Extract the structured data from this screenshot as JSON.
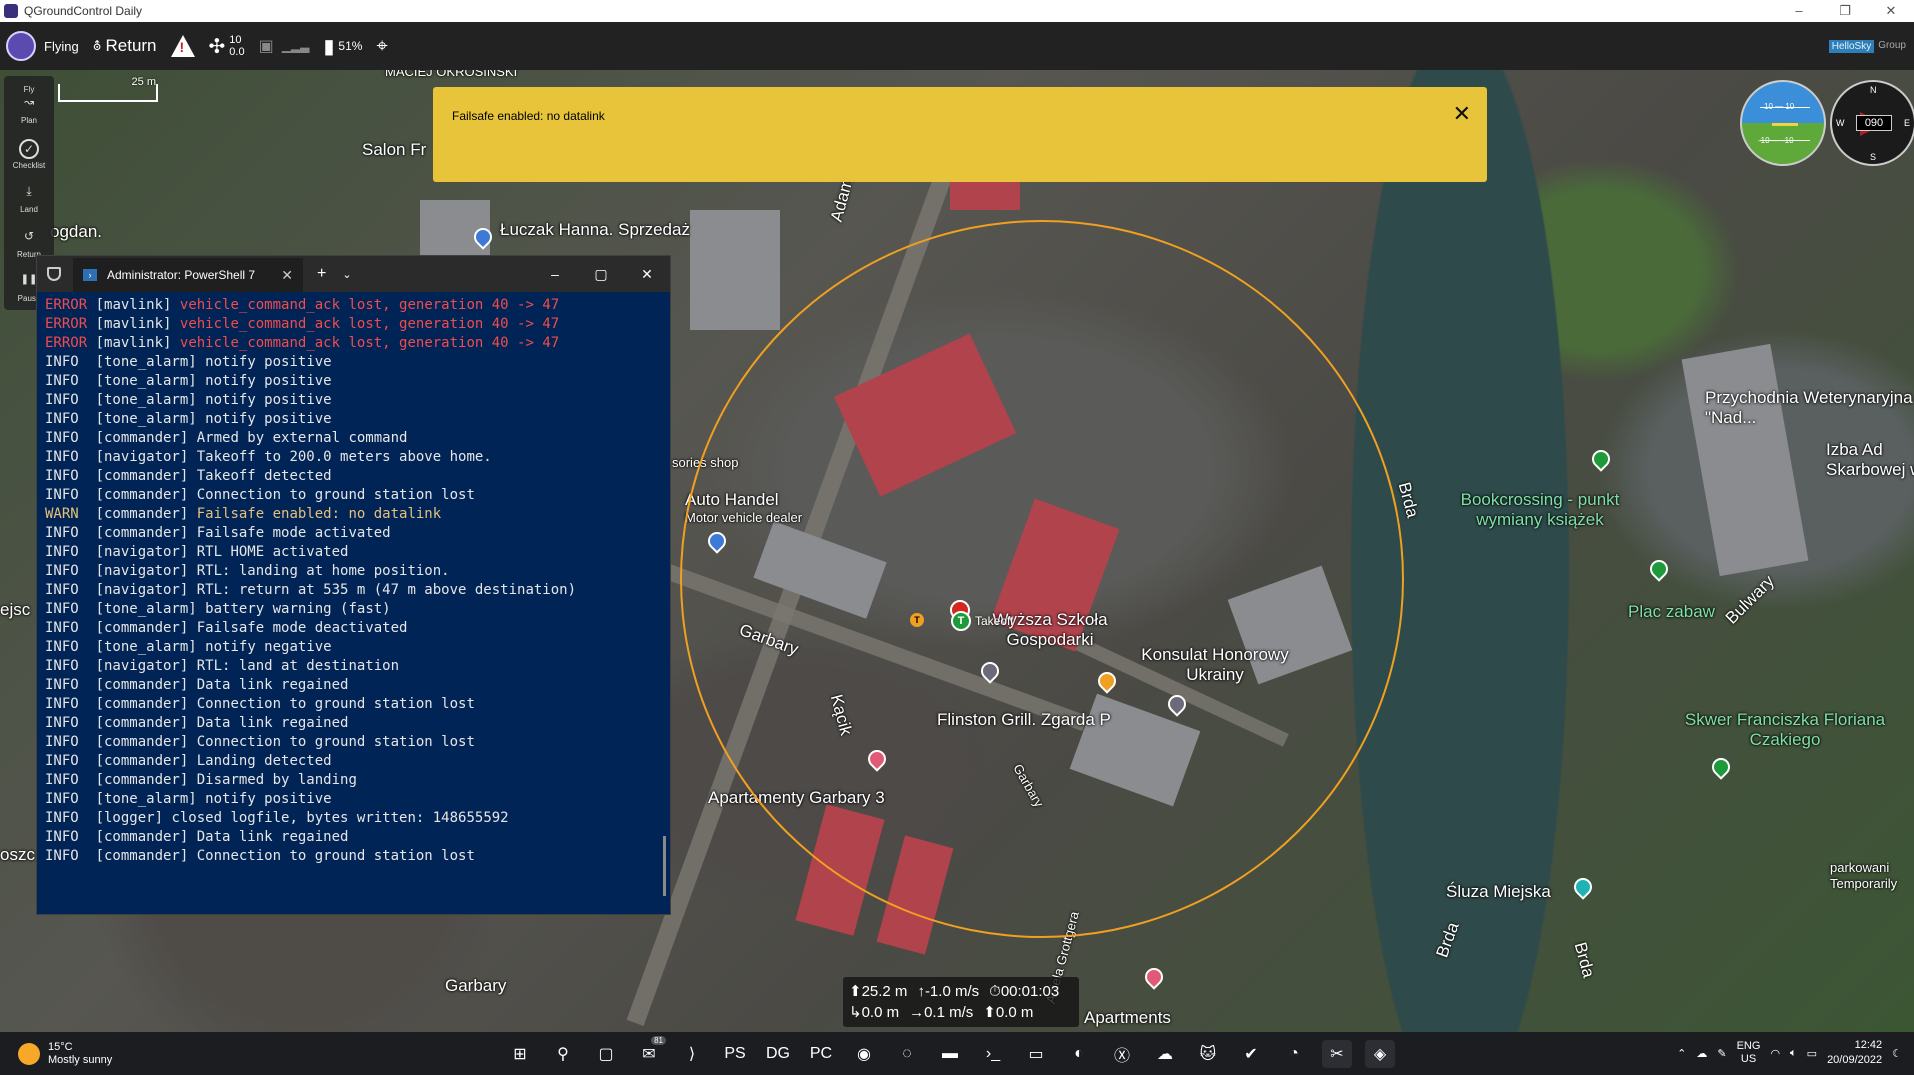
{
  "window": {
    "title": "QGroundControl Daily",
    "controls": [
      "–",
      "❐",
      "✕"
    ]
  },
  "toolbar": {
    "flight_status": "Flying",
    "flight_mode": "Return",
    "gps_count": "10",
    "gps_hdop": "0.0",
    "battery": "51%",
    "brand_left": "HelloSky",
    "brand_right": "Group"
  },
  "tools": [
    {
      "label": "Fly",
      "icon": "✈"
    },
    {
      "label": "Plan",
      "icon": "↝"
    },
    {
      "label": "Checklist",
      "icon": "✓"
    },
    {
      "label": "Land",
      "icon": "⤓"
    },
    {
      "label": "Return",
      "icon": "↺"
    },
    {
      "label": "Pause",
      "icon": "❚❚"
    }
  ],
  "map": {
    "scale": "25 m",
    "labels": [
      "MACIEJ OKROSINSKI",
      "Salon Fr",
      "ogdan.",
      "Łuczak Hanna. Sprzedaż",
      "Auto Handel",
      "Motor vehicle dealer",
      "sories shop",
      "Garbary",
      "Wyższa Szkoła Gospodarki",
      "Konsulat Honorowy Ukrainy",
      "Flinston Grill. Zgarda P",
      "Kącik",
      "Apartamenty Garbary 3",
      "Garbary",
      "Brda",
      "Bookcrossing - punkt wymiany książek",
      "Przychodnia Weterynaryjna \"Nad...",
      "Izba Ad Skarbowej w B",
      "Plac zabaw",
      "Bulwary",
      "Skwer Franciszka Floriana Czakiego",
      "Śluza Miejska",
      "parkowani Temporarily",
      "Apartments",
      "Garbary",
      "Aniela Grottgera",
      "Brda",
      "Brda",
      "Adam",
      "ejsc",
      "oszc"
    ],
    "takeoff_label": "Takeoff",
    "takeoff_marker": "T"
  },
  "banner": {
    "message": "Failsafe enabled: no datalink",
    "close": "✕"
  },
  "instruments": {
    "attitude_top": "10 — 10",
    "attitude_bottom": "-10 — -10",
    "heading": "090",
    "compass_n": "N",
    "compass_e": "E",
    "compass_s": "S",
    "compass_w": "W"
  },
  "telemetry": {
    "altitude": "⬆25.2 m",
    "vertical_speed": "↑-1.0 m/s",
    "flight_time": "⏱00:01:03",
    "distance": "↳0.0 m",
    "ground_speed": "→0.1 m/s",
    "distance_to_home": "⬆0.0 m"
  },
  "powershell": {
    "tab_title": "Administrator: PowerShell 7",
    "lines": [
      {
        "level": "ERROR",
        "module": "[mavlink]",
        "msg": "vehicle_command_ack lost, generation 40 -> 47",
        "type": "error"
      },
      {
        "level": "ERROR",
        "module": "[mavlink]",
        "msg": "vehicle_command_ack lost, generation 40 -> 47",
        "type": "error"
      },
      {
        "level": "ERROR",
        "module": "[mavlink]",
        "msg": "vehicle_command_ack lost, generation 40 -> 47",
        "type": "error"
      },
      {
        "level": "INFO",
        "module": "[tone_alarm]",
        "msg": "notify positive",
        "type": "info"
      },
      {
        "level": "INFO",
        "module": "[tone_alarm]",
        "msg": "notify positive",
        "type": "info"
      },
      {
        "level": "INFO",
        "module": "[tone_alarm]",
        "msg": "notify positive",
        "type": "info"
      },
      {
        "level": "INFO",
        "module": "[tone_alarm]",
        "msg": "notify positive",
        "type": "info"
      },
      {
        "level": "INFO",
        "module": "[commander]",
        "msg": "Armed by external command",
        "type": "info"
      },
      {
        "level": "INFO",
        "module": "[navigator]",
        "msg": "Takeoff to 200.0 meters above home.",
        "type": "info"
      },
      {
        "level": "INFO",
        "module": "[commander]",
        "msg": "Takeoff detected",
        "type": "info"
      },
      {
        "level": "INFO",
        "module": "[commander]",
        "msg": "Connection to ground station lost",
        "type": "info"
      },
      {
        "level": "WARN",
        "module": "[commander]",
        "msg": "Failsafe enabled: no datalink",
        "type": "warn"
      },
      {
        "level": "INFO",
        "module": "[commander]",
        "msg": "Failsafe mode activated",
        "type": "info"
      },
      {
        "level": "INFO",
        "module": "[navigator]",
        "msg": "RTL HOME activated",
        "type": "info"
      },
      {
        "level": "INFO",
        "module": "[navigator]",
        "msg": "RTL: landing at home position.",
        "type": "info"
      },
      {
        "level": "INFO",
        "module": "[navigator]",
        "msg": "RTL: return at 535 m (47 m above destination)",
        "type": "info"
      },
      {
        "level": "INFO",
        "module": "[tone_alarm]",
        "msg": "battery warning (fast)",
        "type": "info"
      },
      {
        "level": "INFO",
        "module": "[commander]",
        "msg": "Failsafe mode deactivated",
        "type": "info"
      },
      {
        "level": "INFO",
        "module": "[tone_alarm]",
        "msg": "notify negative",
        "type": "info"
      },
      {
        "level": "INFO",
        "module": "[navigator]",
        "msg": "RTL: land at destination",
        "type": "info"
      },
      {
        "level": "INFO",
        "module": "[commander]",
        "msg": "Data link regained",
        "type": "info"
      },
      {
        "level": "INFO",
        "module": "[commander]",
        "msg": "Connection to ground station lost",
        "type": "info"
      },
      {
        "level": "INFO",
        "module": "[commander]",
        "msg": "Data link regained",
        "type": "info"
      },
      {
        "level": "INFO",
        "module": "[commander]",
        "msg": "Connection to ground station lost",
        "type": "info"
      },
      {
        "level": "INFO",
        "module": "[commander]",
        "msg": "Landing detected",
        "type": "info"
      },
      {
        "level": "INFO",
        "module": "[commander]",
        "msg": "Disarmed by landing",
        "type": "info"
      },
      {
        "level": "INFO",
        "module": "[tone_alarm]",
        "msg": "notify positive",
        "type": "info"
      },
      {
        "level": "INFO",
        "module": "[logger]",
        "msg": "closed logfile, bytes written: 148655592",
        "type": "info"
      },
      {
        "level": "INFO",
        "module": "[commander]",
        "msg": "Data link regained",
        "type": "info"
      },
      {
        "level": "INFO",
        "module": "[commander]",
        "msg": "Connection to ground station lost",
        "type": "info"
      }
    ]
  },
  "taskbar": {
    "temperature": "15°C",
    "weather": "Mostly sunny",
    "mail_badge": "81",
    "lang_top": "ENG",
    "lang_bottom": "US",
    "time": "12:42",
    "date": "20/09/2022",
    "apps": [
      "windows-start",
      "search",
      "task-view",
      "mail",
      "vscode",
      "phpstorm",
      "datagrip",
      "pycharm",
      "github-desktop",
      "copilot",
      "file-explorer",
      "terminal",
      "console",
      "edge",
      "xbox",
      "onedrive",
      "paint",
      "todo",
      "messenger",
      "snipping",
      "qgroundcontrol"
    ],
    "app_glyphs": [
      "⊞",
      "⚲",
      "▢",
      "✉",
      "⟩",
      "PS",
      "DG",
      "PC",
      "◉",
      "◌",
      "▬",
      "›_",
      "▭",
      "◐",
      "Ⓧ",
      "☁",
      "🐱",
      "✔",
      "◔",
      "✂",
      "◈"
    ]
  },
  "colors": {
    "banner": "#e8c43a",
    "ps_background": "#012456",
    "error": "#f14c4c",
    "warn": "#e5c07b",
    "geofence": "#f0a020"
  }
}
